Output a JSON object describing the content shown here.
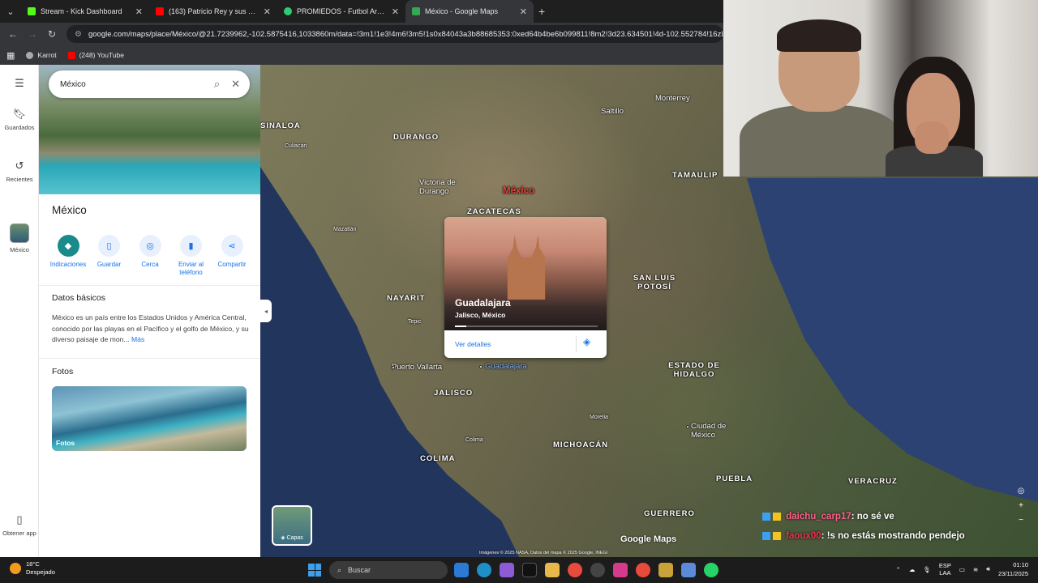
{
  "browser": {
    "tabs": [
      {
        "title": "Stream - Kick Dashboard",
        "color": "#53fc18",
        "active": false
      },
      {
        "title": "(163) Patricio Rey y sus Redond",
        "color": "#ff0000",
        "active": false
      },
      {
        "title": "PROMIEDOS - Futbol Argentino",
        "color": "#2ecc71",
        "active": false
      },
      {
        "title": "México - Google Maps",
        "color": "#34a853",
        "active": true
      }
    ],
    "url": "google.com/maps/place/México/@21.7239962,-102.5875416,1033860m/data=!3m1!1e3!4m6!3m5!1s0x84043a3b88685353:0xed64b4be6b099811!8m2!3d23.634501!4d-102.552784!16zL20vMGI5MA",
    "bookmarks": [
      {
        "label": "Karrot",
        "color": "#aaaaaa"
      },
      {
        "label": "(248) YouTube",
        "color": "#ff0000"
      }
    ]
  },
  "sidebar": {
    "items": [
      {
        "icon": "bookmark-icon",
        "label": "Guardados"
      },
      {
        "icon": "history-icon",
        "label": "Recientes"
      },
      {
        "icon": "place-thumb",
        "label": "México"
      },
      {
        "icon": "phone-icon",
        "label": "Obtener app"
      }
    ]
  },
  "panel": {
    "search_value": "México",
    "place_name": "México",
    "actions": [
      "Indicaciones",
      "Guardar",
      "Cerca",
      "Enviar al teléfono",
      "Compartir"
    ],
    "basic_title": "Datos básicos",
    "description": "México es un país entre los Estados Unidos y América Central, conocido por las playas en el Pacífico y el golfo de México, y su diverso paisaje de mon...",
    "more": "Más",
    "photos_title": "Fotos",
    "photos_label": "Fotos"
  },
  "map": {
    "country_label": "México",
    "labels": {
      "sinaloa": "SINALOA",
      "durango": "DURANGO",
      "zacatecas": "ZACATECAS",
      "nayarit": "NAYARIT",
      "jalisco": "JALISCO",
      "colima": "COLIMA",
      "michoacan": "MICHOACÁN",
      "guerrero": "GUERRERO",
      "puebla": "PUEBLA",
      "veracruz": "VERACRUZ",
      "slp": "SAN LUIS POTOSÍ",
      "hidalgo": "ESTADO DE HIDALGO",
      "tamaulipas": "TAMAULIP",
      "monterrey": "Monterrey",
      "saltillo": "Saltillo",
      "victoria_durango": "Victoria de Durango",
      "puerto_vallarta": "Puerto Vallarta",
      "guadalajara": "Guadalajara",
      "cdmx": "Ciudad de México",
      "culiacan": "Culiacán",
      "mazatlan": "Mazatlán",
      "morelia": "Morelia",
      "tepic": "Tepic",
      "colima_city": "Colima"
    },
    "card": {
      "name": "Guadalajara",
      "subtitle": "Jalisco, México",
      "details": "Ver detalles"
    },
    "layers_label": "Capas",
    "logo": "Google Maps",
    "credits": "Imágenes © 2025 NASA, Datos del mapa © 2025 Google, INEGI"
  },
  "chat": [
    {
      "user": "daichu_carp17",
      "message": ": no sé ve"
    },
    {
      "user": "faoux00",
      "message": ": !s no estás mostrando pendejo"
    }
  ],
  "taskbar": {
    "temp": "18°C",
    "weather": "Despejado",
    "search_placeholder": "Buscar",
    "lang": "ESP",
    "layout": "LAA",
    "time": "01:10",
    "date": "23/11/2025"
  }
}
